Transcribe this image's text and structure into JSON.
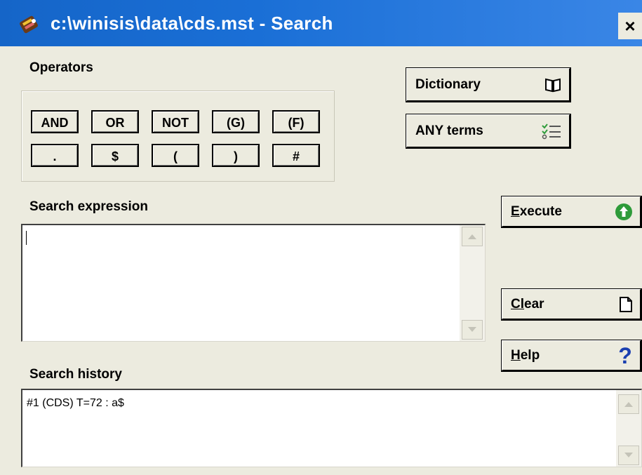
{
  "window": {
    "title": "c:\\winisis\\data\\cds.mst - Search",
    "close_label": "×"
  },
  "operators": {
    "label": "Operators",
    "row1": [
      "AND",
      "OR",
      "NOT",
      "(G)",
      "(F)"
    ],
    "row2": [
      ".",
      "$",
      "(",
      ")",
      "#"
    ]
  },
  "buttons": {
    "dictionary": "Dictionary",
    "any_terms": "ANY terms",
    "execute_hotkey": "E",
    "execute_rest": "xecute",
    "clear_hotkey": "Cl",
    "clear_rest": "ear",
    "help_hotkey": "H",
    "help_rest": "elp"
  },
  "search_expression": {
    "label": "Search expression",
    "value": ""
  },
  "search_history": {
    "label": "Search history",
    "entries": [
      "#1 (CDS) T=72 : a$"
    ]
  },
  "icons": {
    "app": "winisis-app-icon",
    "dictionary": "book-icon",
    "any_terms": "checklist-icon",
    "execute": "green-up-arrow-icon",
    "clear": "blank-page-icon",
    "help": "question-mark-icon"
  },
  "colors": {
    "titlebar": "#1a6fd6",
    "face": "#ecebdf",
    "execute_green": "#2e9b3a",
    "help_blue": "#1a3fb0"
  }
}
